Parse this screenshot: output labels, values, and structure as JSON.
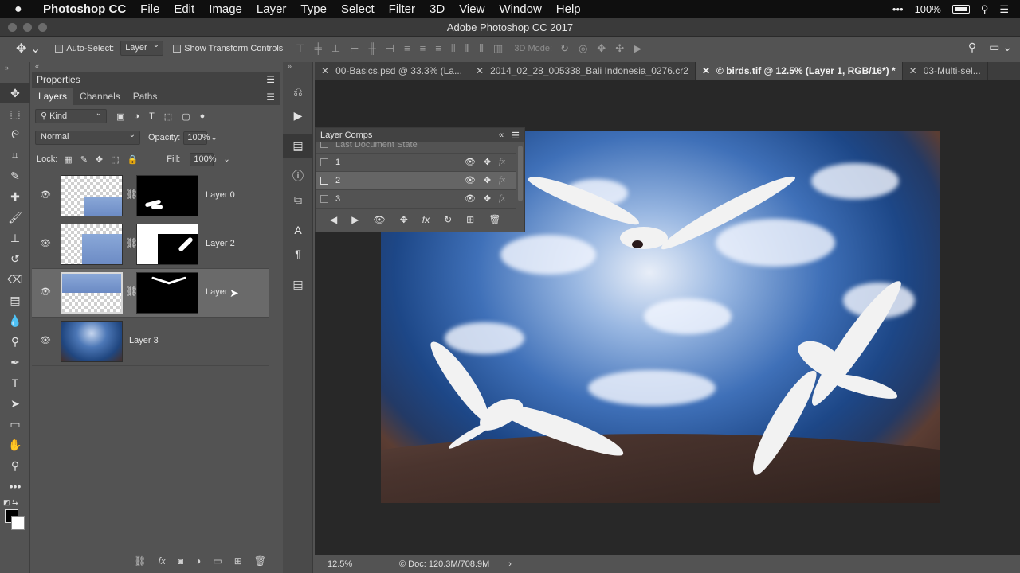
{
  "menubar": {
    "apple": "",
    "app_name": "Photoshop CC",
    "items": [
      "File",
      "Edit",
      "Image",
      "Layer",
      "Type",
      "Select",
      "Filter",
      "3D",
      "View",
      "Window",
      "Help"
    ],
    "battery": "100%"
  },
  "window": {
    "title": "Adobe Photoshop CC 2017"
  },
  "options": {
    "auto_select_label": "Auto-Select:",
    "auto_select_value": "Layer",
    "transform_label": "Show Transform Controls",
    "mode3d_label": "3D Mode:"
  },
  "panel": {
    "properties_title": "Properties",
    "tabs": [
      "Layers",
      "Channels",
      "Paths"
    ],
    "kind_label": "Kind",
    "blend_mode": "Normal",
    "opacity_label": "Opacity:",
    "opacity_value": "100%",
    "lock_label": "Lock:",
    "fill_label": "Fill:",
    "fill_value": "100%",
    "layers": [
      {
        "name": "Layer 0"
      },
      {
        "name": "Layer 2"
      },
      {
        "name": "Layer"
      },
      {
        "name": "Layer 3"
      }
    ]
  },
  "doc_tabs": [
    {
      "label": "00-Basics.psd @ 33.3% (La..."
    },
    {
      "label": "2014_02_28_005338_Bali Indonesia_0276.cr2"
    },
    {
      "label": "© birds.tif @ 12.5% (Layer 1, RGB/16*) *"
    },
    {
      "label": "03-Multi-sel..."
    }
  ],
  "layer_comps": {
    "title": "Layer Comps",
    "partial_row": "Last Document State",
    "rows": [
      {
        "name": "1"
      },
      {
        "name": "2"
      },
      {
        "name": "3"
      }
    ],
    "fx_label": "fx"
  },
  "status": {
    "zoom": "12.5%",
    "doc": "Doc: 120.3M/708.9M"
  }
}
